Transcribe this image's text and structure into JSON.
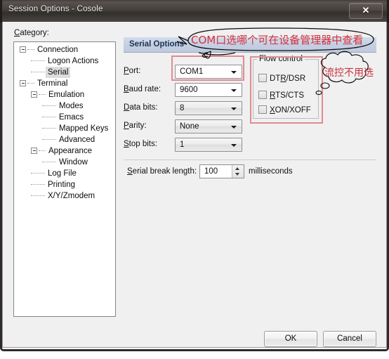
{
  "window": {
    "title": "Session Options - Cosole",
    "close_label": "✕",
    "close_icon": "close-icon"
  },
  "sidebar": {
    "label": "Category:",
    "label_underline": "C",
    "items": [
      {
        "label": "Connection",
        "depth": 0,
        "expander": true,
        "selected": false
      },
      {
        "label": "Logon Actions",
        "depth": 1,
        "expander": false,
        "selected": false
      },
      {
        "label": "Serial",
        "depth": 1,
        "expander": false,
        "selected": true
      },
      {
        "label": "Terminal",
        "depth": 0,
        "expander": true,
        "selected": false
      },
      {
        "label": "Emulation",
        "depth": 1,
        "expander": true,
        "selected": false
      },
      {
        "label": "Modes",
        "depth": 2,
        "expander": false,
        "selected": false
      },
      {
        "label": "Emacs",
        "depth": 2,
        "expander": false,
        "selected": false
      },
      {
        "label": "Mapped Keys",
        "depth": 2,
        "expander": false,
        "selected": false
      },
      {
        "label": "Advanced",
        "depth": 2,
        "expander": false,
        "selected": false
      },
      {
        "label": "Appearance",
        "depth": 1,
        "expander": true,
        "selected": false
      },
      {
        "label": "Window",
        "depth": 2,
        "expander": false,
        "selected": false
      },
      {
        "label": "Log File",
        "depth": 1,
        "expander": false,
        "selected": false
      },
      {
        "label": "Printing",
        "depth": 1,
        "expander": false,
        "selected": false
      },
      {
        "label": "X/Y/Zmodem",
        "depth": 1,
        "expander": false,
        "selected": false
      }
    ]
  },
  "main": {
    "header": "Serial Options",
    "fields": [
      {
        "label": "Port:",
        "underline": "P",
        "value": "COM1",
        "editable": true
      },
      {
        "label": "Baud rate:",
        "underline": "B",
        "value": "9600",
        "editable": true
      },
      {
        "label": "Data bits:",
        "underline": "D",
        "value": "8",
        "editable": false
      },
      {
        "label": "Parity:",
        "underline": "P",
        "value": "None",
        "editable": false
      },
      {
        "label": "Stop bits:",
        "underline": "S",
        "value": "1",
        "editable": false
      }
    ],
    "flow_control": {
      "legend": "Flow control",
      "items": [
        {
          "label": "DTR/DSR",
          "underline": "R",
          "checked": false
        },
        {
          "label": "RTS/CTS",
          "underline": "R",
          "checked": false
        },
        {
          "label": "XON/XOFF",
          "underline": "X",
          "checked": false
        }
      ]
    },
    "serial_break": {
      "label": "Serial break length:",
      "underline": "S",
      "value": "100",
      "units": "milliseconds"
    }
  },
  "footer": {
    "ok_label": "OK",
    "cancel_label": "Cancel"
  },
  "annotations": {
    "com_note": "COM口选哪个可在设备管理器中查看",
    "flow_note": "流控不用选"
  },
  "colors": {
    "annotation_red": "#d6303a",
    "highlight_box": "#e38a90",
    "header_blue": "#c4cfe2",
    "dialog_bg": "#f0f0f0"
  }
}
